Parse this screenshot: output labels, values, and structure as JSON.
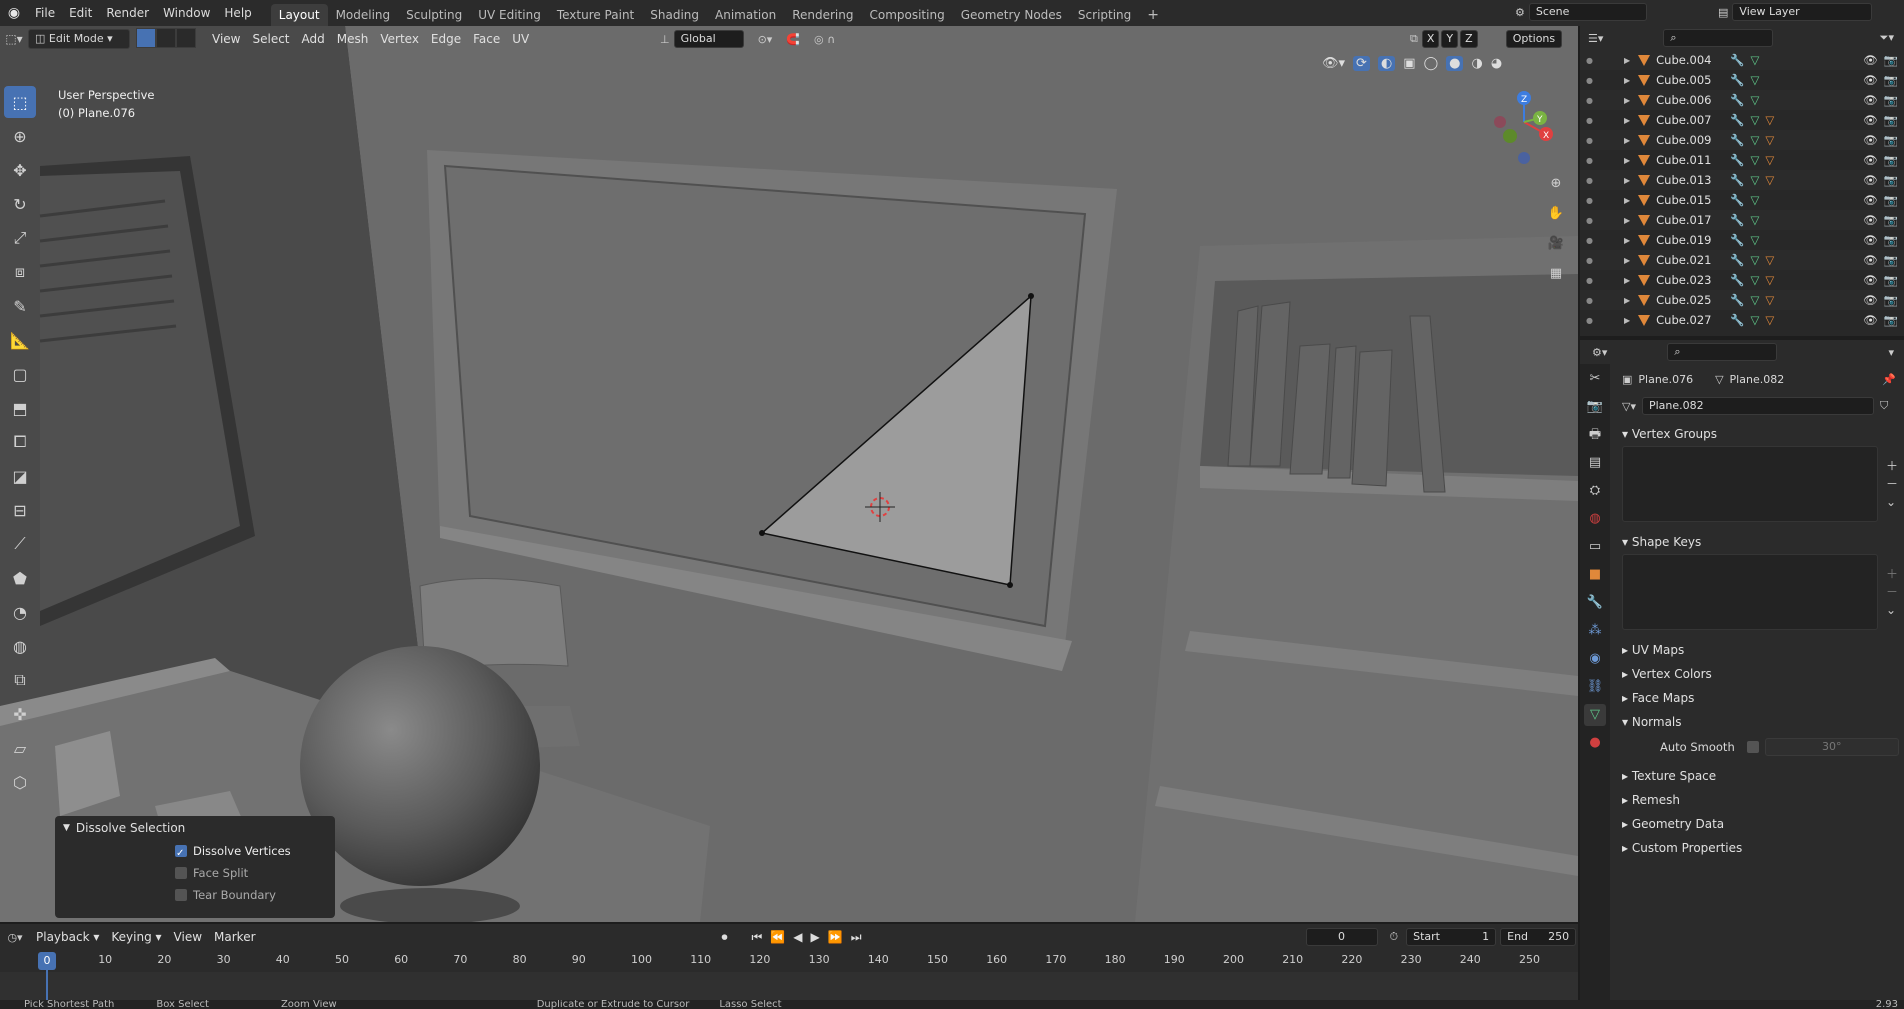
{
  "menu": {
    "items": [
      "File",
      "Edit",
      "Render",
      "Window",
      "Help"
    ],
    "workspaces": [
      "Layout",
      "Modeling",
      "Sculpting",
      "UV Editing",
      "Texture Paint",
      "Shading",
      "Animation",
      "Rendering",
      "Compositing",
      "Geometry Nodes",
      "Scripting"
    ],
    "active_workspace": "Layout",
    "add_tab": "+",
    "scene": "Scene",
    "view_layer": "View Layer"
  },
  "viewport_header": {
    "mode": "Edit Mode",
    "menus": [
      "View",
      "Select",
      "Add",
      "Mesh",
      "Vertex",
      "Edge",
      "Face",
      "UV"
    ],
    "transform": "Global",
    "axes": [
      "X",
      "Y",
      "Z"
    ],
    "options": "Options"
  },
  "viewport": {
    "perspective": "User Perspective",
    "object": "(0) Plane.076",
    "gizmo": {
      "x": "X",
      "y": "Y",
      "z": "Z"
    }
  },
  "redo_panel": {
    "title": "Dissolve Selection",
    "options": [
      {
        "label": "Dissolve Vertices",
        "checked": true
      },
      {
        "label": "Face Split",
        "checked": false
      },
      {
        "label": "Tear Boundary",
        "checked": false
      }
    ]
  },
  "outliner": {
    "rows": [
      {
        "name": "Cube.004",
        "mods": 0
      },
      {
        "name": "Cube.005",
        "mods": 0
      },
      {
        "name": "Cube.006",
        "mods": 0
      },
      {
        "name": "Cube.007",
        "mods": 3
      },
      {
        "name": "Cube.009",
        "mods": 3
      },
      {
        "name": "Cube.011",
        "mods": 3
      },
      {
        "name": "Cube.013",
        "mods": 3
      },
      {
        "name": "Cube.015",
        "mods": 1
      },
      {
        "name": "Cube.017",
        "mods": 1
      },
      {
        "name": "Cube.019",
        "mods": 1
      },
      {
        "name": "Cube.021",
        "mods": 2
      },
      {
        "name": "Cube.023",
        "mods": 3
      },
      {
        "name": "Cube.025",
        "mods": 3
      },
      {
        "name": "Cube.027",
        "mods": 3
      }
    ]
  },
  "properties": {
    "breadcrumb_object": "Plane.076",
    "breadcrumb_data": "Plane.082",
    "mesh_name": "Plane.082",
    "panels": {
      "vertex_groups": "Vertex Groups",
      "shape_keys": "Shape Keys",
      "uv_maps": "UV Maps",
      "vertex_colors": "Vertex Colors",
      "face_maps": "Face Maps",
      "normals": "Normals",
      "auto_smooth": "Auto Smooth",
      "auto_smooth_angle": "30°",
      "texture_space": "Texture Space",
      "remesh": "Remesh",
      "geometry_data": "Geometry Data",
      "custom_properties": "Custom Properties"
    }
  },
  "timeline": {
    "menus": [
      "Playback",
      "Keying",
      "View",
      "Marker"
    ],
    "current_frame": "0",
    "start_label": "Start",
    "start": "1",
    "end_label": "End",
    "end": "250",
    "ticks": [
      "0",
      "10",
      "20",
      "30",
      "40",
      "50",
      "60",
      "70",
      "80",
      "90",
      "100",
      "110",
      "120",
      "130",
      "140",
      "150",
      "160",
      "170",
      "180",
      "190",
      "200",
      "210",
      "220",
      "230",
      "240",
      "250"
    ]
  },
  "status": {
    "items": [
      "Pick Shortest Path",
      "Box Select",
      "Zoom View",
      "Duplicate or Extrude to Cursor",
      "Lasso Select"
    ],
    "version": "2.93"
  },
  "colors": {
    "accent": "#4772b3",
    "object_orange": "#e0883a",
    "mesh_green": "#5fc78a",
    "wrench_blue": "#6e9ad6"
  }
}
